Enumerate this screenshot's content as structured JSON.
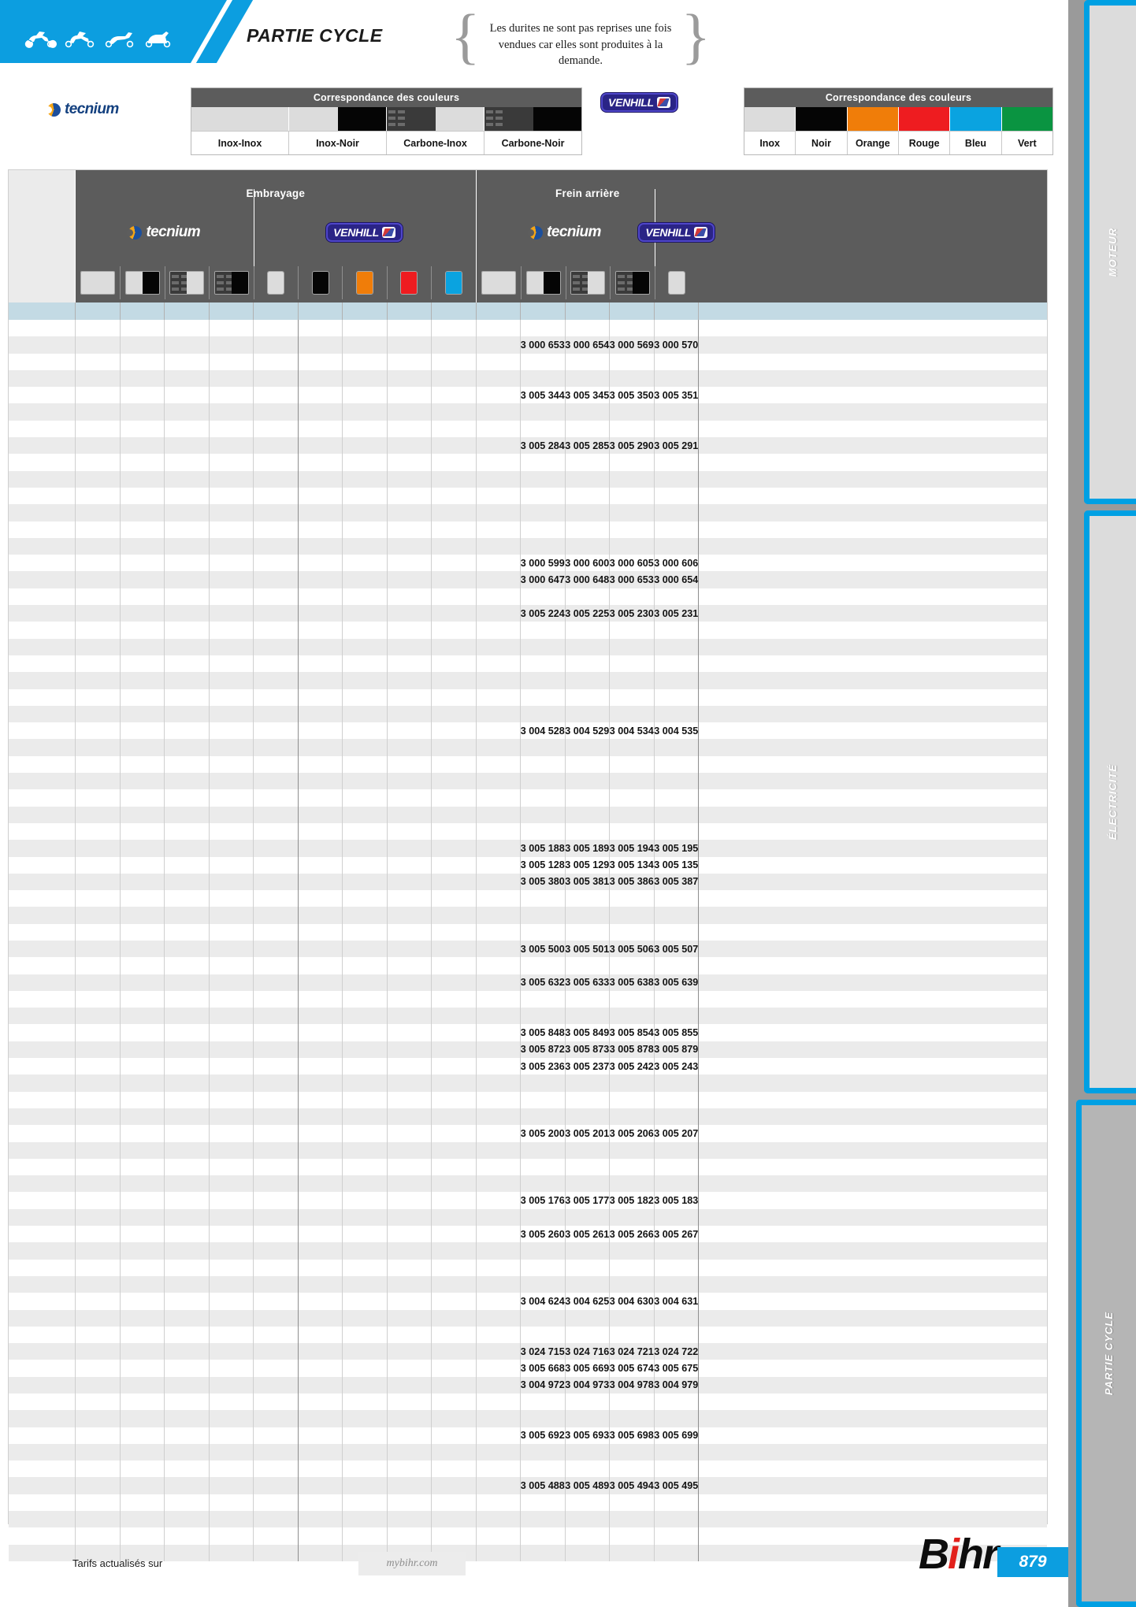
{
  "header": {
    "title": "PARTIE CYCLE",
    "note": "Les durites ne sont pas reprises une fois vendues car elles sont produites à la demande.",
    "vehicle_icons": [
      "sportbike-icon",
      "roadster-icon",
      "scooter-icon",
      "maxiscooter-icon"
    ]
  },
  "correspondence": {
    "tecnium": {
      "logo": "tecnium-logo",
      "title": "Correspondance des couleurs",
      "columns": [
        {
          "label": "Inox-Inox",
          "swatch": [
            "inox",
            "inox"
          ]
        },
        {
          "label": "Inox-Noir",
          "swatch": [
            "inox",
            "noir"
          ]
        },
        {
          "label": "Carbone-Inox",
          "swatch": [
            "carbone",
            "inox"
          ]
        },
        {
          "label": "Carbone-Noir",
          "swatch": [
            "carbone",
            "noir"
          ]
        }
      ]
    },
    "venhill": {
      "logo": "venhill-logo",
      "title": "Correspondance des couleurs",
      "columns": [
        {
          "label": "Inox",
          "swatch": [
            "inox"
          ]
        },
        {
          "label": "Noir",
          "swatch": [
            "noir"
          ]
        },
        {
          "label": "Orange",
          "swatch": [
            "orange"
          ]
        },
        {
          "label": "Rouge",
          "swatch": [
            "rouge"
          ]
        },
        {
          "label": "Bleu",
          "swatch": [
            "bleu"
          ]
        },
        {
          "label": "Vert",
          "swatch": [
            "vert"
          ]
        }
      ]
    }
  },
  "colors": {
    "inox": "#dcdcdc",
    "noir": "#050505",
    "carbone": "#3a3a3a",
    "orange": "#f07d09",
    "rouge": "#ee1c20",
    "bleu": "#0aa3e0",
    "vert": "#0a9441",
    "accent_blue": "#0c9ee0",
    "header_gray": "#5c5c5c",
    "row_alt": "#ebebeb",
    "subhead_blue": "#c3dae4",
    "bihr_red": "#e2211c"
  },
  "table": {
    "groups": [
      {
        "title": "Embrayage",
        "brands": [
          {
            "logo": "tecnium-logo",
            "swatches": [
              [
                "inox",
                "inox"
              ],
              [
                "inox",
                "noir"
              ],
              [
                "carbone",
                "inox"
              ],
              [
                "carbone",
                "noir"
              ]
            ]
          },
          {
            "logo": "venhill-logo",
            "swatches": [
              [
                "inox"
              ],
              [
                "noir"
              ],
              [
                "orange"
              ],
              [
                "rouge"
              ],
              [
                "bleu"
              ]
            ]
          }
        ]
      },
      {
        "title": "Frein arrière",
        "brands": [
          {
            "logo": "tecnium-logo",
            "swatches": [
              [
                "inox",
                "inox"
              ],
              [
                "inox",
                "noir"
              ],
              [
                "carbone",
                "inox"
              ],
              [
                "carbone",
                "noir"
              ]
            ]
          },
          {
            "logo": "venhill-logo",
            "swatches": [
              [
                "inox"
              ]
            ]
          }
        ]
      }
    ],
    "column_count": 15,
    "rows": [
      {
        "shade": "plain",
        "refs": {
          "10": "",
          "11": "",
          "12": "",
          "13": ""
        }
      },
      {
        "shade": "alt",
        "refs": {
          "10": "3 000 653",
          "11": "3 000 654",
          "12": "3 000 569",
          "13": "3 000 570"
        }
      },
      {
        "shade": "plain",
        "refs": {}
      },
      {
        "shade": "alt",
        "refs": {}
      },
      {
        "shade": "plain",
        "refs": {
          "10": "3 005 344",
          "11": "3 005 345",
          "12": "3 005 350",
          "13": "3 005 351"
        }
      },
      {
        "shade": "alt",
        "refs": {}
      },
      {
        "shade": "plain",
        "refs": {}
      },
      {
        "shade": "alt",
        "refs": {
          "10": "3 005 284",
          "11": "3 005 285",
          "12": "3 005 290",
          "13": "3 005 291"
        }
      },
      {
        "shade": "plain",
        "refs": {}
      },
      {
        "shade": "alt",
        "refs": {}
      },
      {
        "shade": "plain",
        "refs": {}
      },
      {
        "shade": "alt",
        "refs": {}
      },
      {
        "shade": "plain",
        "refs": {}
      },
      {
        "shade": "alt",
        "refs": {}
      },
      {
        "shade": "plain",
        "refs": {
          "10": "3 000 599",
          "11": "3 000 600",
          "12": "3 000 605",
          "13": "3 000 606"
        }
      },
      {
        "shade": "alt",
        "refs": {
          "10": "3 000 647",
          "11": "3 000 648",
          "12": "3 000 653",
          "13": "3 000 654"
        }
      },
      {
        "shade": "plain",
        "refs": {}
      },
      {
        "shade": "alt",
        "refs": {
          "10": "3 005 224",
          "11": "3 005 225",
          "12": "3 005 230",
          "13": "3 005 231"
        }
      },
      {
        "shade": "plain",
        "refs": {}
      },
      {
        "shade": "alt",
        "refs": {}
      },
      {
        "shade": "plain",
        "refs": {}
      },
      {
        "shade": "alt",
        "refs": {}
      },
      {
        "shade": "plain",
        "refs": {}
      },
      {
        "shade": "alt",
        "refs": {}
      },
      {
        "shade": "plain",
        "refs": {
          "10": "3 004 528",
          "11": "3 004 529",
          "12": "3 004 534",
          "13": "3 004 535"
        }
      },
      {
        "shade": "alt",
        "refs": {}
      },
      {
        "shade": "plain",
        "refs": {}
      },
      {
        "shade": "alt",
        "refs": {}
      },
      {
        "shade": "plain",
        "refs": {}
      },
      {
        "shade": "alt",
        "refs": {}
      },
      {
        "shade": "plain",
        "refs": {}
      },
      {
        "shade": "alt",
        "refs": {
          "10": "3 005 188",
          "11": "3 005 189",
          "12": "3 005 194",
          "13": "3 005 195"
        }
      },
      {
        "shade": "plain",
        "refs": {
          "10": "3 005 128",
          "11": "3 005 129",
          "12": "3 005 134",
          "13": "3 005 135"
        }
      },
      {
        "shade": "alt",
        "refs": {
          "10": "3 005 380",
          "11": "3 005 381",
          "12": "3 005 386",
          "13": "3 005 387"
        }
      },
      {
        "shade": "plain",
        "refs": {}
      },
      {
        "shade": "alt",
        "refs": {}
      },
      {
        "shade": "plain",
        "refs": {}
      },
      {
        "shade": "alt",
        "refs": {
          "10": "3 005 500",
          "11": "3 005 501",
          "12": "3 005 506",
          "13": "3 005 507"
        }
      },
      {
        "shade": "plain",
        "refs": {}
      },
      {
        "shade": "alt",
        "refs": {
          "10": "3 005 632",
          "11": "3 005 633",
          "12": "3 005 638",
          "13": "3 005 639"
        }
      },
      {
        "shade": "plain",
        "refs": {}
      },
      {
        "shade": "alt",
        "refs": {}
      },
      {
        "shade": "plain",
        "refs": {
          "10": "3 005 848",
          "11": "3 005 849",
          "12": "3 005 854",
          "13": "3 005 855"
        }
      },
      {
        "shade": "alt",
        "refs": {
          "10": "3 005 872",
          "11": "3 005 873",
          "12": "3 005 878",
          "13": "3 005 879"
        }
      },
      {
        "shade": "plain",
        "refs": {
          "10": "3 005 236",
          "11": "3 005 237",
          "12": "3 005 242",
          "13": "3 005 243"
        }
      },
      {
        "shade": "alt",
        "refs": {}
      },
      {
        "shade": "plain",
        "refs": {}
      },
      {
        "shade": "alt",
        "refs": {}
      },
      {
        "shade": "plain",
        "refs": {
          "10": "3 005 200",
          "11": "3 005 201",
          "12": "3 005 206",
          "13": "3 005 207"
        }
      },
      {
        "shade": "alt",
        "refs": {}
      },
      {
        "shade": "plain",
        "refs": {}
      },
      {
        "shade": "alt",
        "refs": {}
      },
      {
        "shade": "plain",
        "refs": {
          "10": "3 005 176",
          "11": "3 005 177",
          "12": "3 005 182",
          "13": "3 005 183"
        }
      },
      {
        "shade": "alt",
        "refs": {}
      },
      {
        "shade": "plain",
        "refs": {
          "10": "3 005 260",
          "11": "3 005 261",
          "12": "3 005 266",
          "13": "3 005 267"
        }
      },
      {
        "shade": "alt",
        "refs": {}
      },
      {
        "shade": "plain",
        "refs": {}
      },
      {
        "shade": "alt",
        "refs": {}
      },
      {
        "shade": "plain",
        "refs": {
          "10": "3 004 624",
          "11": "3 004 625",
          "12": "3 004 630",
          "13": "3 004 631"
        }
      },
      {
        "shade": "alt",
        "refs": {}
      },
      {
        "shade": "plain",
        "refs": {}
      },
      {
        "shade": "alt",
        "refs": {
          "10": "3 024 715",
          "11": "3 024 716",
          "12": "3 024 721",
          "13": "3 024 722"
        }
      },
      {
        "shade": "plain",
        "refs": {
          "10": "3 005 668",
          "11": "3 005 669",
          "12": "3 005 674",
          "13": "3 005 675"
        }
      },
      {
        "shade": "alt",
        "refs": {
          "10": "3 004 972",
          "11": "3 004 973",
          "12": "3 004 978",
          "13": "3 004 979"
        }
      },
      {
        "shade": "plain",
        "refs": {}
      },
      {
        "shade": "alt",
        "refs": {}
      },
      {
        "shade": "plain",
        "refs": {
          "10": "3 005 692",
          "11": "3 005 693",
          "12": "3 005 698",
          "13": "3 005 699"
        }
      },
      {
        "shade": "alt",
        "refs": {}
      },
      {
        "shade": "plain",
        "refs": {}
      },
      {
        "shade": "alt",
        "refs": {
          "10": "3 005 488",
          "11": "3 005 489",
          "12": "3 005 494",
          "13": "3 005 495"
        }
      },
      {
        "shade": "plain",
        "refs": {}
      },
      {
        "shade": "alt",
        "refs": {}
      },
      {
        "shade": "plain",
        "refs": {}
      },
      {
        "shade": "alt",
        "refs": {}
      }
    ]
  },
  "sidebar": {
    "tabs": [
      {
        "label": "MOTEUR",
        "active": false
      },
      {
        "label": "ÉLECTRICITÉ",
        "active": false
      },
      {
        "label": "PARTIE CYCLE",
        "active": true
      }
    ]
  },
  "footer": {
    "tariff_text": "Tarifs actualisés sur",
    "url": "mybihr.com",
    "brand": "Bihr",
    "page": "879"
  }
}
